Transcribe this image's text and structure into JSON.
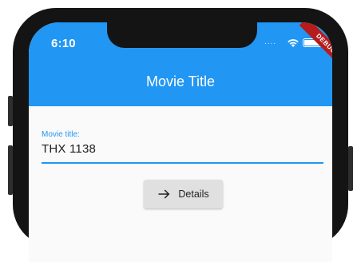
{
  "status_bar": {
    "time": "6:10",
    "signal_dots": "....",
    "icons": [
      "wifi-icon",
      "battery-icon"
    ]
  },
  "debug_banner": "DEBUG",
  "app_bar": {
    "title": "Movie Title",
    "color": "#2196f3"
  },
  "form": {
    "label": "Movie title:",
    "value": "THX 1138"
  },
  "details_button": {
    "label": "Details",
    "icon": "arrow-forward-icon"
  },
  "colors": {
    "primary": "#2196f3",
    "button_bg": "#e0e0e0",
    "debug_banner": "#b71c1c"
  }
}
